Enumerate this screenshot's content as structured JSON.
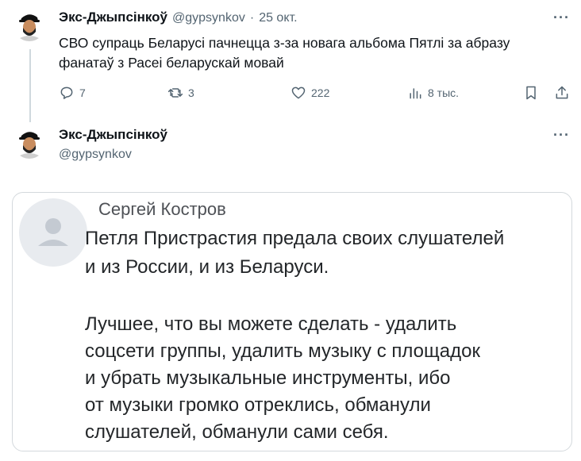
{
  "tweet1": {
    "author_name": "Экс-Джыпсінкоў",
    "handle": "@gypsynkov",
    "separator": "·",
    "date": "25 окт.",
    "text_line1": "СВО супраць Беларусі пачнецца з-за новага альбома Пятлі за абразу",
    "text_line2": "фанатаў з Расеі беларускай мовай",
    "actions": {
      "replies": "7",
      "retweets": "3",
      "likes": "222",
      "views": "8 тыс."
    },
    "more": "···"
  },
  "tweet2": {
    "author_name": "Экс-Джыпсінкоў",
    "handle": "@gypsynkov",
    "more": "···"
  },
  "quoted_post": {
    "author": "Сергей Костров",
    "paragraph1": [
      "Петля Пристрастия предала своих слушателей",
      "и из России, и из Беларуси."
    ],
    "paragraph2": [
      "Лучшее, что вы можете сделать - удалить",
      "соцсети группы, удалить музыку с площадок",
      "и убрать музыкальные инструменты, ибо",
      "от музыки громко отреклись, обманули",
      "слушателей, обманули сами себя."
    ]
  },
  "icons": [
    "avatar-cartoon-icon",
    "reply-icon",
    "retweet-icon",
    "like-icon",
    "views-icon",
    "bookmark-icon",
    "share-icon",
    "more-icon",
    "default-user-icon"
  ]
}
